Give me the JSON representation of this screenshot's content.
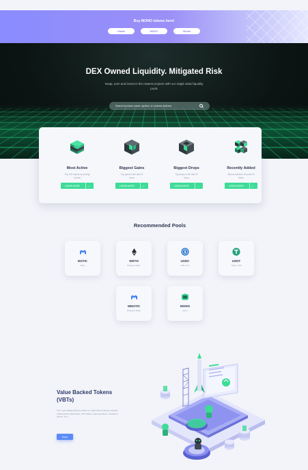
{
  "promo": {
    "title": "Buy MONO tokens here!",
    "buttons": [
      "Haskil",
      "WBSC",
      "Moxsil"
    ]
  },
  "hero": {
    "title": "DEX Owned Liquidity. Mitigated Risk",
    "subtitle_line1": "Swap, earn and invest in the newest projects with our single sided liquidity",
    "subtitle_line2": "pools",
    "search_placeholder": "Search by token name, symbol, or contract address"
  },
  "features": [
    {
      "title": "Most Active",
      "desc1": "Top 100 tokens by trading",
      "desc2": "volume",
      "button": "LEARN MORE",
      "icon": "green-cube-stack-icon"
    },
    {
      "title": "Biggest Gains",
      "desc1": "Top gains in the last 24",
      "desc2": "hours",
      "button": "LEARN MORE",
      "icon": "dark-cube-green-icon"
    },
    {
      "title": "Biggest Drops",
      "desc1": "Top drops in the last 24",
      "desc2": "hours",
      "button": "LEARN MORE",
      "icon": "dark-cube-drop-icon"
    },
    {
      "title": "Recently Added",
      "desc1": "Tokens added in the past 24",
      "desc2": "hours",
      "button": "LEARN MORE",
      "icon": "cube-cluster-icon"
    }
  ],
  "recommended": {
    "title": "Recommended Pools",
    "pools": [
      {
        "symbol": "MATIC",
        "name": "Matic",
        "icon": "matic-icon"
      },
      {
        "symbol": "WETH",
        "name": "Wrapped Ether",
        "icon": "eth-icon"
      },
      {
        "symbol": "USDC",
        "name": "USD Coin",
        "icon": "usdc-icon"
      },
      {
        "symbol": "USDT",
        "name": "Tether USD",
        "icon": "usdt-icon"
      },
      {
        "symbol": "WMATIC",
        "name": "Wrapped Matic",
        "icon": "matic-icon"
      },
      {
        "symbol": "MONO",
        "name": "Mono",
        "icon": "mono-icon"
      }
    ]
  },
  "vbt": {
    "title_line1": "Value Backed Tokens",
    "title_line2": "(VBTs)",
    "desc": "The most capital efficient solution to trade tokens that are already collateralized (Synthetics, LPT shares, Gaming tokens, Insurance tokens, etc.)",
    "button": "Docs"
  },
  "colors": {
    "accent": "#3ddc97",
    "brand": "#8a8cff",
    "primary_button": "#5b8bf7"
  }
}
